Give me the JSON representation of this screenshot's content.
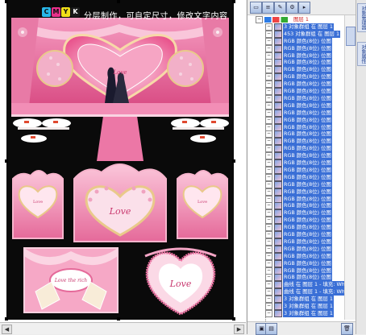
{
  "canvas": {
    "caption": "分层制作，可自定尺寸，修改文字内容",
    "cmyk_letters": [
      "C",
      "M",
      "Y",
      "K"
    ],
    "cmyk_colors": [
      "#29b6e8",
      "#e8308a",
      "#f2e019",
      "#1a1a1a"
    ]
  },
  "stage_texts": {
    "backdrop_logo": "Love",
    "card_left": "Love",
    "card_center": "Love",
    "card_right": "Love",
    "panel_bottom_left": "Love the rich",
    "panel_bottom_right": "Love"
  },
  "object_manager": {
    "toolbar_buttons": [
      "page-icon",
      "layers-icon",
      "edit-icon",
      "options-icon",
      "menu-arrow-icon"
    ],
    "rows": [
      {
        "label": "图层 1",
        "selected": false
      },
      {
        "label": "3 对象群组 在 图层 1",
        "selected": true
      },
      {
        "label": "453 对象群组 在 图层 1",
        "selected": true
      },
      {
        "label": "RGB 颜色(8位) 位图",
        "selected": true
      },
      {
        "label": "RGB 颜色(8位) 位图",
        "selected": true
      },
      {
        "label": "RGB 颜色(8位) 位图",
        "selected": true
      },
      {
        "label": "RGB 颜色(8位) 位图",
        "selected": true
      },
      {
        "label": "RGB 颜色(8位) 位图",
        "selected": true
      },
      {
        "label": "RGB 颜色(8位) 位图",
        "selected": true
      },
      {
        "label": "RGB 颜色(8位) 位图",
        "selected": true
      },
      {
        "label": "RGB 颜色(8位) 位图",
        "selected": true
      },
      {
        "label": "RGB 颜色(8位) 位图",
        "selected": true
      },
      {
        "label": "RGB 颜色(8位) 位图",
        "selected": true
      },
      {
        "label": "RGB 颜色(8位) 位图",
        "selected": true
      },
      {
        "label": "RGB 颜色(8位) 位图",
        "selected": true
      },
      {
        "label": "RGB 颜色(8位) 位图",
        "selected": true
      },
      {
        "label": "RGB 颜色(8位) 位图",
        "selected": true
      },
      {
        "label": "RGB 颜色(8位) 位图",
        "selected": true
      },
      {
        "label": "RGB 颜色(8位) 位图",
        "selected": true
      },
      {
        "label": "RGB 颜色(8位) 位图",
        "selected": true
      },
      {
        "label": "RGB 颜色(8位) 位图",
        "selected": true
      },
      {
        "label": "RGB 颜色(8位) 位图",
        "selected": true
      },
      {
        "label": "RGB 颜色(8位) 位图",
        "selected": true
      },
      {
        "label": "RGB 颜色(8位) 位图",
        "selected": true
      },
      {
        "label": "RGB 颜色(8位) 位图",
        "selected": true
      },
      {
        "label": "RGB 颜色(8位) 位图",
        "selected": true
      },
      {
        "label": "RGB 颜色(8位) 位图",
        "selected": true
      },
      {
        "label": "RGB 颜色(8位) 位图",
        "selected": true
      },
      {
        "label": "RGB 颜色(8位) 位图",
        "selected": true
      },
      {
        "label": "RGB 颜色(8位) 位图",
        "selected": true
      },
      {
        "label": "RGB 颜色(8位) 位图",
        "selected": true
      },
      {
        "label": "RGB 颜色(8位) 位图",
        "selected": true
      },
      {
        "label": "RGB 颜色(8位) 位图",
        "selected": true
      },
      {
        "label": "RGB 颜色(8位) 位图",
        "selected": true
      },
      {
        "label": "RGB 颜色(8位) 位图",
        "selected": true
      },
      {
        "label": "RGB 颜色(8位) 位图",
        "selected": true
      },
      {
        "label": "RGB 颜色(8位) 位图",
        "selected": true
      },
      {
        "label": "曲线 在 图层 1 - 填充: White",
        "selected": true
      },
      {
        "label": "曲线 在 图层 1 - 填充: White",
        "selected": true
      },
      {
        "label": "3 对象群组 在 图层 1",
        "selected": true
      },
      {
        "label": "3 对象群组 在 图层 1",
        "selected": true
      },
      {
        "label": "3 对象群组 在 图层 1",
        "selected": true
      }
    ],
    "footer_buttons": [
      "new-layer-icon",
      "new-master-layer-icon",
      "delete-icon"
    ]
  },
  "side_tabs": [
    "对象管理器",
    "对象属性"
  ],
  "colors": {
    "selection": "#3a6fd6",
    "pink_light": "#f8b8d0",
    "pink_mid": "#ee6fa1",
    "pink_deep": "#c9386f",
    "gold": "#e9c98a"
  }
}
